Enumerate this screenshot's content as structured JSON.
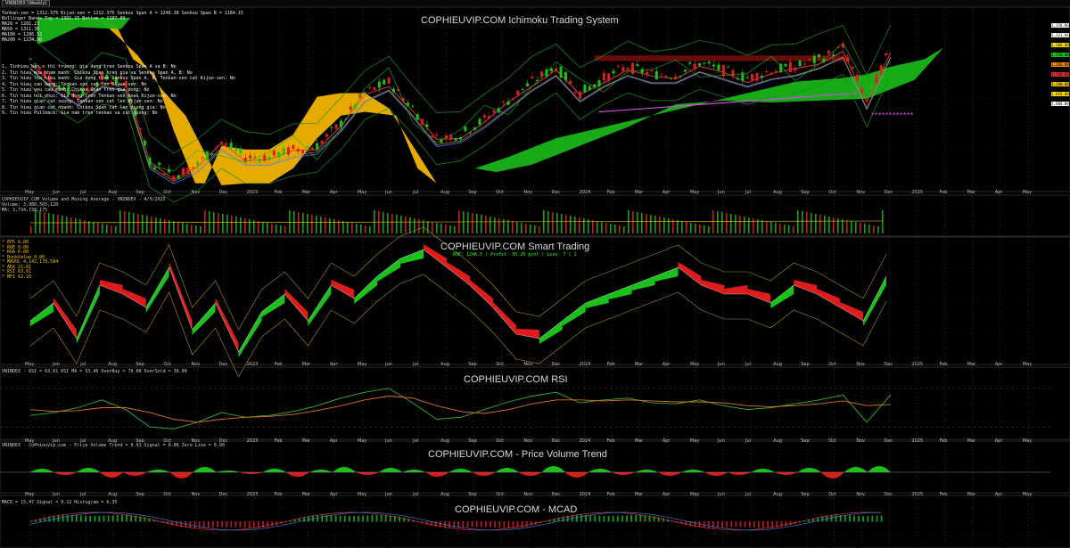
{
  "window": {
    "tab_label": "VNINDEX (Weekly)"
  },
  "panels": {
    "ichimoku": {
      "title": "COPHIEUVIP.COM Ichimoku Trading System",
      "legend_lines": [
        "Tenkan-sen = 1312.375    Kijun-sen = 1212.375   Senkou Span A = 1246.38   Senkou Span B = 1184.15",
        "Bollinger Bands Top = 1391.15   Bottom = 1187.89",
        "MA20 = 1281.23",
        "MA50 = 1311.38",
        "MA100 = 1286.52",
        "MA200 = 1234.80"
      ],
      "signal_notes": [
        "1. Tinhieu ban o thi truong: gia dang tren Senkou Span A va B: No",
        "2. Tin hieu mua nham manh: Chikou Span tren gia va Senkou Span A, B: No",
        "3. Tin hieu tin hieu manh: Gia dong tren Senkou Span A, B, Tenkan-sen cat Kijun-sen: No",
        "4. Tin hieu can bang: Tenkan-sen cat len Kijun-sen: No",
        "5. Tin hieu yeu cau manh: Chikou Span tren gia dong: No",
        "6. Tin hieu hoi phuc: Gia dong tren Tenkan-sen hoac Kijun-sen: No",
        "7. Tin hieu gian cat xuong: Tenkan-sen cat len Kijun-sen: No",
        "8. Tin hieu gian cat nhanh: Chikou Span cat len duong gia: No",
        "9. Tin hieu Pullback: Gia nam tren tenkan va cat xuong: No"
      ]
    },
    "volume": {
      "title": "COPHIEUVIP.COM Volume and Moving Average - VNINDEX - 4/5/2025",
      "values_line": "Volume: 3,980,565,120",
      "ma_line": "MA: 3,734,738,175"
    },
    "smart": {
      "title": "COPHIEUVIP.COM Smart Trading",
      "stats_line": "ROE: 1246.5 | Profit: 95.20 pcnt | Loss: 7 | 1",
      "legend_lines": [
        "* EPS    0.00",
        "* ROE    0.00",
        "* ROA    0.00",
        "* BookValue    0.00",
        "* MAVOL 4,142,178,584",
        "* ADX    21.81",
        "* RSI    63.61",
        "* MFI    62.10"
      ]
    },
    "rsi": {
      "title": "COPHIEUVIP.COM RSI",
      "legend": "VNINDEX - RSI = 63.61    RSI MA = 53.46   OverBuy = 70.00   OverSold = 30.00"
    },
    "pvt": {
      "title": "COPHIEUVIP.COM - Price Volume Trend",
      "legend": "VNINDEX - CoPhieuvip.com - Price Volume Trend = 0.91    Signal = 0.86   Zero Line = 0.00"
    },
    "macd": {
      "title": "COPHIEUVIP.COM - MCAD",
      "legend": "MACD = 15.47    Signal = 9.12    Histogram = 6.35"
    }
  },
  "time_axis": {
    "labels": [
      "May",
      "Jun",
      "Jul",
      "Aug",
      "Sep",
      "Oct",
      "Nov",
      "Dec",
      "2023",
      "Feb",
      "Mar",
      "Apr",
      "May",
      "Jun",
      "Jul",
      "Aug",
      "Sep",
      "Oct",
      "Nov",
      "Dec",
      "2024",
      "Feb",
      "Mar",
      "Apr",
      "May",
      "Jun",
      "Jul",
      "Aug",
      "Sep",
      "Oct",
      "Nov",
      "Dec",
      "2025",
      "Feb",
      "Mar",
      "Apr",
      "May",
      "Jun"
    ]
  },
  "price_scale": {
    "tags": [
      "1,350.00",
      "1,321.04",
      "1,300.00",
      "1,250.00",
      "1,200.00",
      "1,150.00",
      "1,100.00",
      "1,050.00",
      "1,000.00"
    ]
  },
  "colors": {
    "bull": "#19c219",
    "bear": "#e01b1b",
    "cloud_green": "#18b418",
    "cloud_orange": "#f2b400",
    "price_line": "#ffffff",
    "grid": "#262626",
    "rsi_line": "#2fb32f",
    "rsi_ma": "#e07028"
  },
  "chart_data": [
    {
      "type": "line",
      "title": "COPHIEUVIP.COM Ichimoku Trading System",
      "x": [
        "May 22",
        "Jun 22",
        "Jul 22",
        "Aug 22",
        "Sep 22",
        "Oct 22",
        "Nov 22",
        "Dec 22",
        "Jan 23",
        "Feb 23",
        "Mar 23",
        "Apr 23",
        "May 23",
        "Jun 23",
        "Jul 23",
        "Aug 23",
        "Sep 23",
        "Oct 23",
        "Nov 23",
        "Dec 23",
        "Jan 24",
        "Feb 24",
        "Mar 24",
        "Apr 24",
        "May 24",
        "Jun 24",
        "Jul 24",
        "Aug 24",
        "Sep 24",
        "Oct 24",
        "Nov 24",
        "Dec 24",
        "Jan 25",
        "Feb 25",
        "Mar 25",
        "Apr 25",
        "May 25"
      ],
      "series": [
        {
          "values": [
            1290,
            1230,
            1190,
            1240,
            1230,
            1020,
            980,
            1010,
            1070,
            1030,
            1030,
            1050,
            1060,
            1120,
            1200,
            1230,
            1160,
            1080,
            1090,
            1130,
            1180,
            1230,
            1270,
            1200,
            1240,
            1270,
            1250,
            1250,
            1280,
            1260,
            1240,
            1260,
            1270,
            1290,
            1320,
            1180,
            1321.04
          ]
        }
      ],
      "ylim": [
        950,
        1400
      ]
    },
    {
      "type": "line",
      "title": "COPHIEUVIP.COM RSI",
      "x": [
        "May 22",
        "Jun 22",
        "Jul 22",
        "Aug 22",
        "Sep 22",
        "Oct 22",
        "Nov 22",
        "Dec 22",
        "Jan 23",
        "Feb 23",
        "Mar 23",
        "Apr 23",
        "May 23",
        "Jun 23",
        "Jul 23",
        "Aug 23",
        "Sep 23",
        "Oct 23",
        "Nov 23",
        "Dec 23",
        "Jan 24",
        "Feb 24",
        "Mar 24",
        "Apr 24",
        "May 24",
        "Jun 24",
        "Jul 24",
        "Aug 24",
        "Sep 24",
        "Oct 24",
        "Nov 24",
        "Dec 24",
        "Jan 25",
        "Feb 25",
        "Mar 25",
        "Apr 25",
        "May 25"
      ],
      "series": [
        {
          "name": "RSI",
          "values": [
            42,
            45,
            50,
            58,
            48,
            30,
            28,
            35,
            45,
            40,
            42,
            46,
            52,
            60,
            66,
            70,
            55,
            38,
            40,
            48,
            56,
            62,
            66,
            55,
            58,
            60,
            55,
            54,
            58,
            52,
            48,
            50,
            54,
            58,
            63,
            35,
            63.61
          ]
        },
        {
          "name": "RSI MA",
          "values": [
            48,
            46,
            47,
            50,
            50,
            45,
            38,
            35,
            38,
            40,
            41,
            43,
            47,
            52,
            58,
            62,
            60,
            52,
            46,
            44,
            48,
            54,
            58,
            58,
            57,
            58,
            57,
            56,
            56,
            55,
            52,
            51,
            52,
            54,
            57,
            52,
            53.46
          ]
        }
      ],
      "ylim": [
        20,
        80
      ]
    }
  ]
}
